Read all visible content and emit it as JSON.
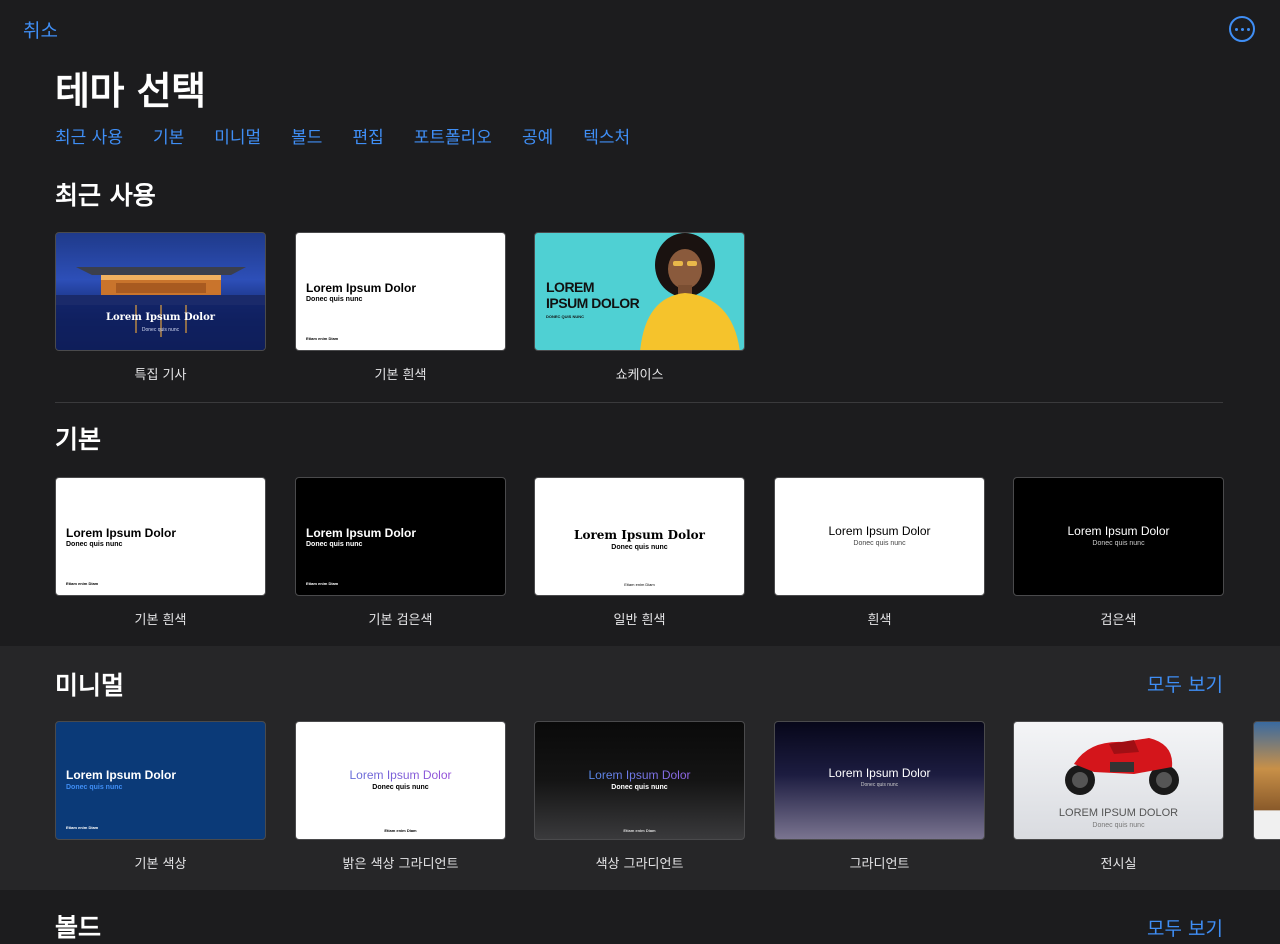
{
  "header": {
    "cancel": "취소",
    "title": "테마 선택"
  },
  "nav": [
    "최근 사용",
    "기본",
    "미니멀",
    "볼드",
    "편집",
    "포트폴리오",
    "공예",
    "텍스처"
  ],
  "sections": {
    "recent": {
      "title": "최근 사용",
      "cards": [
        "특집 기사",
        "기본 흰색",
        "쇼케이스"
      ]
    },
    "basic": {
      "title": "기본",
      "cards": [
        "기본 흰색",
        "기본 검은색",
        "일반 흰색",
        "흰색",
        "검은색"
      ]
    },
    "minimal": {
      "title": "미니멀",
      "see_all": "모두 보기",
      "cards": [
        "기본 색상",
        "밝은 색상 그라디언트",
        "색상 그라디언트",
        "그라디언트",
        "전시실"
      ]
    },
    "bold": {
      "title": "볼드",
      "see_all": "모두 보기"
    }
  },
  "thumb_text": {
    "title": "Lorem Ipsum Dolor",
    "title_caps": "LOREM IPSUM DOLOR",
    "showcase_line1": "LOREM",
    "showcase_line2": "IPSUM DOLOR",
    "subtitle": "Donec quis nunc",
    "subtitle_caps": "DONEC QUIS NUNC",
    "footer": "Etiam enim Diam"
  },
  "colors": {
    "accent": "#3f8ef5",
    "background": "#1c1c1e",
    "section_alt": "#262628"
  }
}
